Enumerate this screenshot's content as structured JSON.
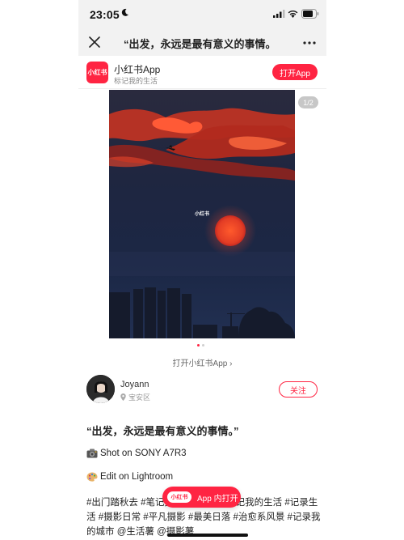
{
  "status_bar": {
    "time": "23:05"
  },
  "nav": {
    "title": "“出发，永远是最有意义的事情。"
  },
  "app_banner": {
    "logo_text": "小红书",
    "name": "小红书App",
    "tagline": "标记我的生活",
    "open_button": "打开App"
  },
  "photo": {
    "watermark": "小红书",
    "page_counter": "1/2",
    "current_index": 1,
    "total": 2
  },
  "open_in_app_link": "打开小红书App ›",
  "author": {
    "name": "Joyann",
    "location": "宝安区",
    "follow_button": "关注"
  },
  "post": {
    "title": "“出发，永远是最有意义的事情。”",
    "shot_line": "Shot on SONY A7R3",
    "edit_line": "Edit on Lightroom",
    "tags": "#出门踏秋去 #笔记灵感 #记录吧 #标记我的生活 #记录生活 #摄影日常 #平凡摄影 #最美日落 #治愈系风景 #记录我的城市 @生活薯 @摄影薯"
  },
  "float_button": {
    "logo_text": "小红书",
    "label": "App 内打开"
  },
  "colors": {
    "brand": "#ff2442",
    "nav_bg": "#f2f2f2",
    "sky": "#1d2843",
    "sun": "#e8452c"
  },
  "icons": [
    "moon-icon",
    "signal-icon",
    "wifi-icon",
    "battery-icon",
    "close-icon",
    "more-icon",
    "location-icon",
    "camera-icon",
    "palette-icon"
  ]
}
